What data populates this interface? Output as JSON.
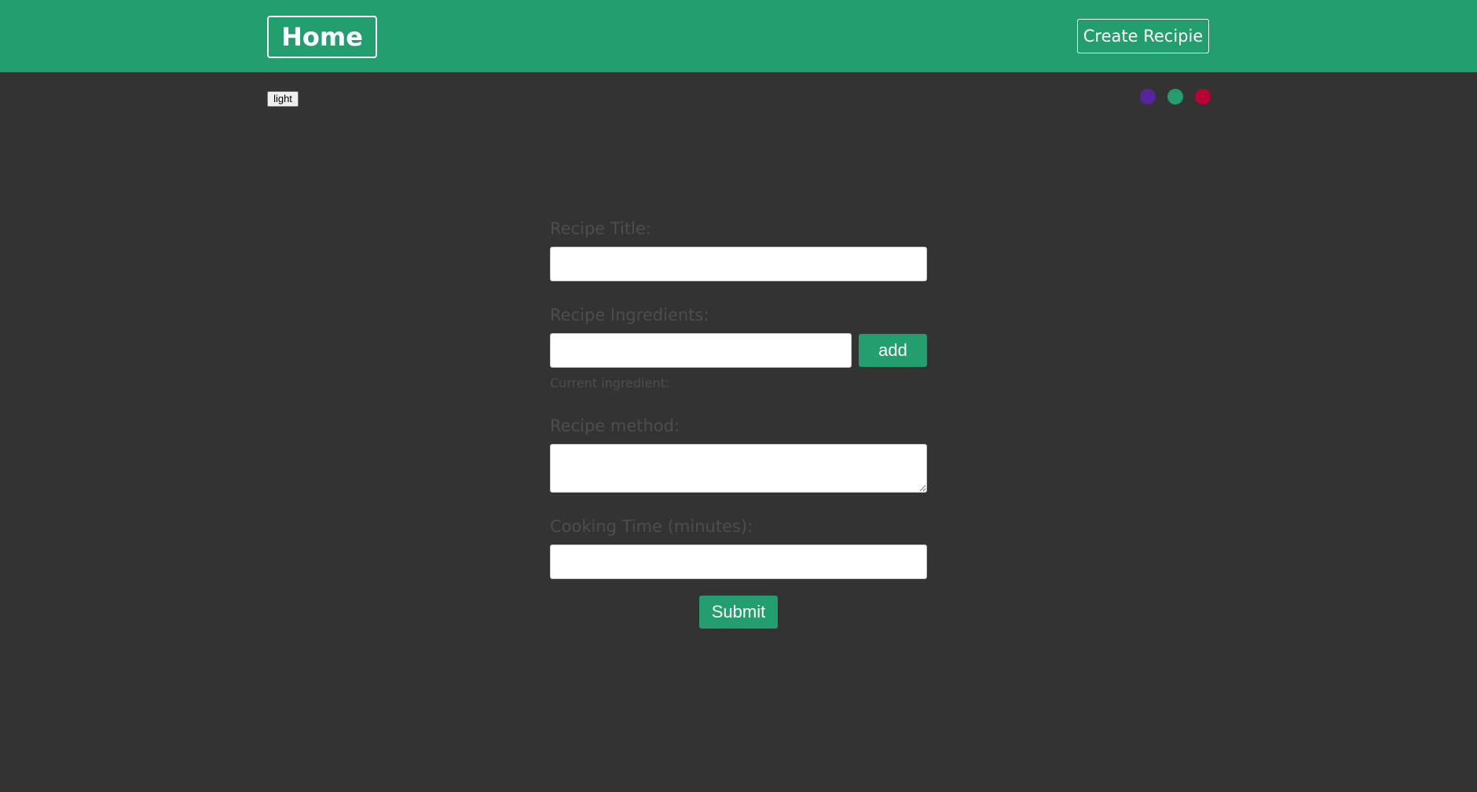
{
  "header": {
    "home_label": "Home",
    "create_label": "Create Recipie"
  },
  "theme": {
    "toggle_label": "light",
    "swatches": [
      {
        "name": "purple",
        "color": "#58249c"
      },
      {
        "name": "green",
        "color": "#249c6b"
      },
      {
        "name": "red",
        "color": "#b70233"
      }
    ]
  },
  "form": {
    "title_label": "Recipe Title:",
    "title_value": "",
    "ingredients_label": "Recipe Ingredients:",
    "ingredient_value": "",
    "add_label": "add",
    "current_ingredient_label": "Current ingredient:",
    "method_label": "Recipe method:",
    "method_value": "",
    "cooking_time_label": "Cooking Time (minutes):",
    "cooking_time_value": "",
    "submit_label": "Submit"
  },
  "colors": {
    "accent": "#229e6f",
    "background": "#333333",
    "label": "#4d4d4d"
  }
}
